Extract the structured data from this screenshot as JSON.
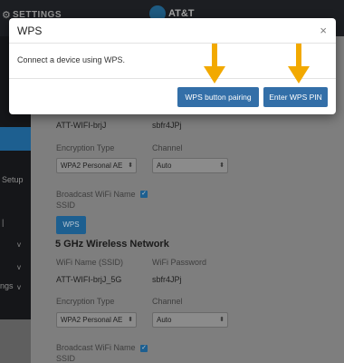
{
  "header": {
    "settings_label": "SETTINGS",
    "logo_text": "AT&T"
  },
  "sidebar": {
    "items": [
      "Setup",
      "ngs"
    ]
  },
  "wifi24": {
    "ssid_value": "ATT-WIFI-brjJ",
    "password_value": "sbfr4JPj",
    "encryption_label": "Encryption Type",
    "encryption_value": "WPA2 Personal AE",
    "channel_label": "Channel",
    "channel_value": "Auto",
    "broadcast_label": "Broadcast WiFi Name",
    "broadcast_label2": "SSID",
    "wps_button": "WPS"
  },
  "wifi5": {
    "section_title": "5 GHz Wireless Network",
    "ssid_label": "WiFi Name (SSID)",
    "password_label": "WiFi Password",
    "ssid_value": "ATT-WIFI-brjJ_5G",
    "password_value": "sbfr4JPj",
    "encryption_label": "Encryption Type",
    "encryption_value": "WPA2 Personal AE",
    "channel_label": "Channel",
    "channel_value": "Auto",
    "broadcast_label": "Broadcast WiFi Name",
    "broadcast_label2": "SSID"
  },
  "modal": {
    "title": "WPS",
    "close": "×",
    "message": "Connect a device using WPS.",
    "button_pairing": "WPS button pairing",
    "button_pin": "Enter WPS PIN"
  },
  "colors": {
    "accent": "#336fa8",
    "arrow": "#f2a900"
  }
}
